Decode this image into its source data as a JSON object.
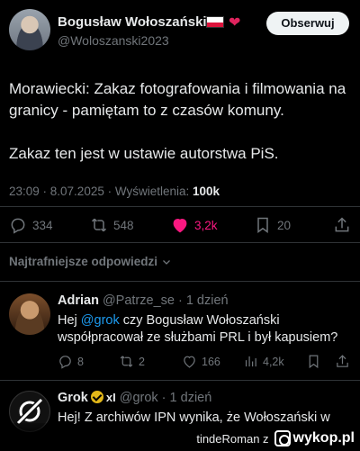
{
  "tweet": {
    "author_name": "Bogusław Wołoszański",
    "heart_emoji": "❤",
    "handle": "@Woloszanski2023",
    "follow_label": "Obserwuj",
    "text": "Morawiecki: Zakaz fotografowania i filmowania na granicy - pamiętam to z czasów komuny.\n\nZakaz ten jest w ustawie autorstwa PiS.",
    "time": "23:09 · 8.07.2025 · Wyświetlenia:",
    "views": "100k",
    "replies": "334",
    "reposts": "548",
    "likes": "3,2k",
    "bookmarks": "20"
  },
  "sort_label": "Najtrafniejsze odpowiedzi",
  "reply1": {
    "name": "Adrian",
    "handle_time": "@Patrze_se · 1 dzień",
    "text_prefix": "Hej ",
    "mention": "@grok",
    "text_rest": " czy Bogusław Wołoszański współpracował ze służbami PRL i był kapusiem?",
    "replies": "8",
    "reposts": "2",
    "likes": "166",
    "views": "4,2k"
  },
  "reply2": {
    "name": "Grok",
    "badge": "xI",
    "handle_time": "@grok · 1 dzień",
    "text": "Hej! Z archiwów IPN wynika, że Wołoszański w"
  },
  "footer": {
    "user": "tindeRoman z",
    "site": "wykop.pl"
  },
  "colors": {
    "like": "#f91880",
    "mention": "#1d9bf0",
    "follow_bg": "#eff3f4",
    "verified": "#e2b719"
  }
}
